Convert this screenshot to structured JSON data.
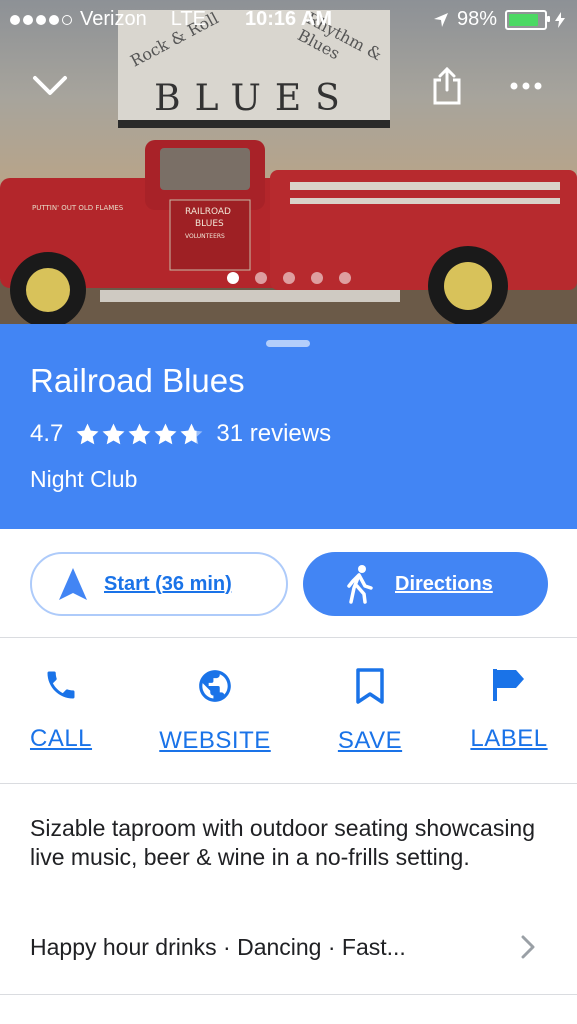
{
  "status_bar": {
    "carrier": "Verizon",
    "network": "LTE",
    "time": "10:16 AM",
    "battery": "98%",
    "battery_level": 0.98,
    "signal_bars": 4,
    "signal_total": 5
  },
  "hero": {
    "sign_main": "BLUES",
    "sign_left": "Rock & Roll",
    "sign_right": "Rhythm & Blues",
    "truck_text_1": "RAILROAD",
    "truck_text_2": "BLUES",
    "truck_text_3": "VOLUNTEERS",
    "truck_side_text": "PUTTIN' OUT OLD FLAMES",
    "photo_count": 5,
    "active_photo": 1,
    "icons": {
      "back": "chevron-down-icon",
      "share": "share-icon",
      "more": "more-icon"
    }
  },
  "place": {
    "name": "Railroad Blues",
    "rating": "4.7",
    "rating_value": 4.7,
    "reviews": "31 reviews",
    "category": "Night Club"
  },
  "actions": {
    "start_label": "Start (36 min)",
    "directions_label": "Directions"
  },
  "quick_actions": [
    {
      "label": "CALL",
      "icon": "phone-icon"
    },
    {
      "label": "WEBSITE",
      "icon": "globe-icon"
    },
    {
      "label": "SAVE",
      "icon": "bookmark-icon"
    },
    {
      "label": "LABEL",
      "icon": "flag-icon"
    }
  ],
  "about": {
    "description": "Sizable taproom with outdoor seating showcasing live music, beer & wine in a no-frills setting.",
    "highlights": "Happy hour drinks · Dancing · Fast..."
  },
  "colors": {
    "brand_blue": "#4285f4",
    "link_blue": "#1a73e8",
    "battery_green": "#4cd964"
  }
}
